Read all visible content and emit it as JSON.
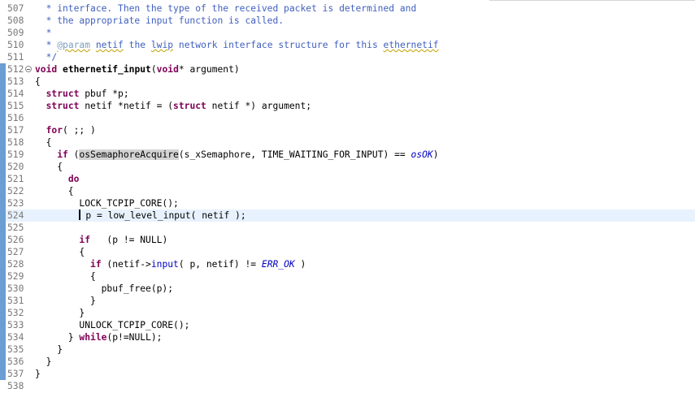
{
  "editor": {
    "lines": [
      {
        "num": "507",
        "segs": [
          {
            "t": "  * interface. Then the type of the received packet is determined and",
            "c": "comment"
          }
        ]
      },
      {
        "num": "508",
        "segs": [
          {
            "t": "  * the appropriate input function is called.",
            "c": "comment"
          }
        ]
      },
      {
        "num": "509",
        "segs": [
          {
            "t": "  *",
            "c": "comment"
          }
        ]
      },
      {
        "num": "510",
        "segs": [
          {
            "t": "  * ",
            "c": "comment"
          },
          {
            "t": "@param",
            "c": "tag squiggle"
          },
          {
            "t": " ",
            "c": "comment"
          },
          {
            "t": "netif",
            "c": "comment squiggle"
          },
          {
            "t": " the ",
            "c": "comment"
          },
          {
            "t": "lwip",
            "c": "comment squiggle"
          },
          {
            "t": " network interface structure for this ",
            "c": "comment"
          },
          {
            "t": "ethernetif",
            "c": "comment squiggle"
          }
        ]
      },
      {
        "num": "511",
        "segs": [
          {
            "t": "  */",
            "c": "comment"
          }
        ]
      },
      {
        "num": "512",
        "fold": true,
        "segs": [
          {
            "t": "void",
            "c": "kw"
          },
          {
            "t": " ",
            "c": ""
          },
          {
            "t": "ethernetif_input",
            "c": "fn"
          },
          {
            "t": "(",
            "c": ""
          },
          {
            "t": "void",
            "c": "kw"
          },
          {
            "t": "* argument)",
            "c": ""
          }
        ]
      },
      {
        "num": "513",
        "segs": [
          {
            "t": "{",
            "c": ""
          }
        ]
      },
      {
        "num": "514",
        "segs": [
          {
            "t": "  ",
            "c": ""
          },
          {
            "t": "struct",
            "c": "kw"
          },
          {
            "t": " pbuf *p;",
            "c": ""
          }
        ]
      },
      {
        "num": "515",
        "segs": [
          {
            "t": "  ",
            "c": ""
          },
          {
            "t": "struct",
            "c": "kw"
          },
          {
            "t": " netif *netif = (",
            "c": ""
          },
          {
            "t": "struct",
            "c": "kw"
          },
          {
            "t": " netif *) argument;",
            "c": ""
          }
        ]
      },
      {
        "num": "516",
        "segs": []
      },
      {
        "num": "517",
        "segs": [
          {
            "t": "  ",
            "c": ""
          },
          {
            "t": "for",
            "c": "kw"
          },
          {
            "t": "( ;; )",
            "c": ""
          }
        ]
      },
      {
        "num": "518",
        "segs": [
          {
            "t": "  {",
            "c": ""
          }
        ]
      },
      {
        "num": "519",
        "segs": [
          {
            "t": "    ",
            "c": ""
          },
          {
            "t": "if",
            "c": "kw"
          },
          {
            "t": " (",
            "c": ""
          },
          {
            "t": "osSemaphoreAcquire",
            "c": "hl"
          },
          {
            "t": "(s_xSemaphore, TIME_WAITING_FOR_INPUT) == ",
            "c": ""
          },
          {
            "t": "osOK",
            "c": "macro-it"
          },
          {
            "t": ")",
            "c": ""
          }
        ]
      },
      {
        "num": "520",
        "segs": [
          {
            "t": "    {",
            "c": ""
          }
        ]
      },
      {
        "num": "521",
        "segs": [
          {
            "t": "      ",
            "c": ""
          },
          {
            "t": "do",
            "c": "kw"
          }
        ]
      },
      {
        "num": "522",
        "segs": [
          {
            "t": "      {",
            "c": ""
          }
        ]
      },
      {
        "num": "523",
        "segs": [
          {
            "t": "        LOCK_TCPIP_CORE();",
            "c": ""
          }
        ]
      },
      {
        "num": "524",
        "current": true,
        "caret": true,
        "segs": [
          {
            "t": "p = low_level_input( netif );",
            "c": ""
          }
        ]
      },
      {
        "num": "525",
        "segs": []
      },
      {
        "num": "526",
        "segs": [
          {
            "t": "        ",
            "c": ""
          },
          {
            "t": "if",
            "c": "kw"
          },
          {
            "t": "   (p != NULL)",
            "c": ""
          }
        ]
      },
      {
        "num": "527",
        "segs": [
          {
            "t": "        {",
            "c": ""
          }
        ]
      },
      {
        "num": "528",
        "segs": [
          {
            "t": "          ",
            "c": ""
          },
          {
            "t": "if",
            "c": "kw"
          },
          {
            "t": " (netif->",
            "c": ""
          },
          {
            "t": "input",
            "c": "fld"
          },
          {
            "t": "( p, netif) != ",
            "c": ""
          },
          {
            "t": "ERR_OK",
            "c": "macro-it"
          },
          {
            "t": " )",
            "c": ""
          }
        ]
      },
      {
        "num": "529",
        "segs": [
          {
            "t": "          {",
            "c": ""
          }
        ]
      },
      {
        "num": "530",
        "segs": [
          {
            "t": "            pbuf_free(p);",
            "c": ""
          }
        ]
      },
      {
        "num": "531",
        "segs": [
          {
            "t": "          }",
            "c": ""
          }
        ]
      },
      {
        "num": "532",
        "segs": [
          {
            "t": "        }",
            "c": ""
          }
        ]
      },
      {
        "num": "533",
        "segs": [
          {
            "t": "        UNLOCK_TCPIP_CORE();",
            "c": ""
          }
        ]
      },
      {
        "num": "534",
        "segs": [
          {
            "t": "      } ",
            "c": ""
          },
          {
            "t": "while",
            "c": "kw"
          },
          {
            "t": "(p!=NULL);",
            "c": ""
          }
        ]
      },
      {
        "num": "535",
        "segs": [
          {
            "t": "    }",
            "c": ""
          }
        ]
      },
      {
        "num": "536",
        "segs": [
          {
            "t": "  }",
            "c": ""
          }
        ]
      },
      {
        "num": "537",
        "segs": [
          {
            "t": "}",
            "c": ""
          }
        ]
      },
      {
        "num": "538",
        "nodiff": true,
        "segs": []
      }
    ],
    "caret_indent": "        "
  }
}
